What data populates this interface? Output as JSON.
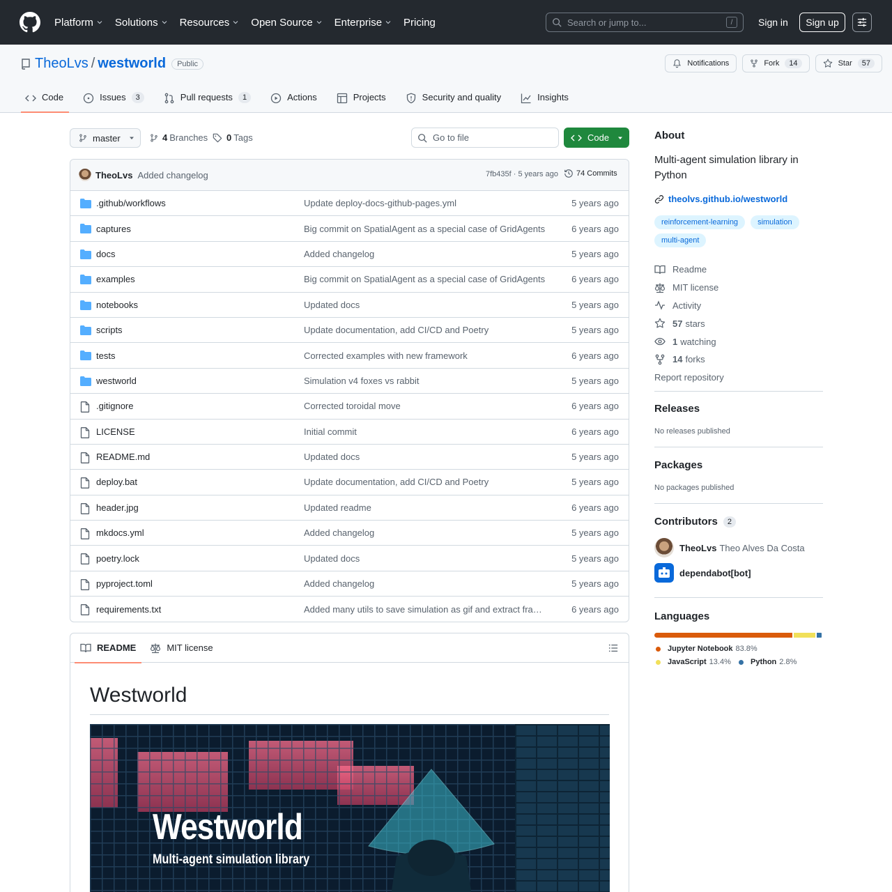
{
  "topnav": {
    "items": [
      "Platform",
      "Solutions",
      "Resources",
      "Open Source",
      "Enterprise",
      "Pricing"
    ],
    "search_placeholder": "Search or jump to...",
    "search_shortcut": "/",
    "signin": "Sign in",
    "signup": "Sign up"
  },
  "repo": {
    "owner": "TheoLvs",
    "separator": "/",
    "name": "westworld",
    "visibility": "Public",
    "notifications": "Notifications",
    "fork_label": "Fork",
    "fork_count": "14",
    "star_label": "Star",
    "star_count": "57"
  },
  "tabs": [
    {
      "label": "Code",
      "count": null,
      "icon": "code-icon",
      "active": true
    },
    {
      "label": "Issues",
      "count": "3",
      "icon": "issue-icon"
    },
    {
      "label": "Pull requests",
      "count": "1",
      "icon": "pull-request-icon"
    },
    {
      "label": "Actions",
      "count": null,
      "icon": "play-icon"
    },
    {
      "label": "Projects",
      "count": null,
      "icon": "table-icon"
    },
    {
      "label": "Security and quality",
      "count": null,
      "icon": "shield-icon"
    },
    {
      "label": "Insights",
      "count": null,
      "icon": "graph-icon"
    }
  ],
  "toolbar": {
    "branch": "master",
    "branches_count": "4",
    "branches_label": "Branches",
    "tags_count": "0",
    "tags_label": "Tags",
    "goto_placeholder": "Go to file",
    "code_button": "Code"
  },
  "latest_commit": {
    "author": "TheoLvs",
    "message": "Added changelog",
    "sha_time": "7fb435f · 5 years ago",
    "commits": "74 Commits"
  },
  "files": [
    {
      "name": ".github/workflows",
      "type": "dir",
      "message": "Update deploy-docs-github-pages.yml",
      "date": "5 years ago"
    },
    {
      "name": "captures",
      "type": "dir",
      "message": "Big commit on SpatialAgent as a special case of GridAgents",
      "date": "6 years ago"
    },
    {
      "name": "docs",
      "type": "dir",
      "message": "Added changelog",
      "date": "5 years ago"
    },
    {
      "name": "examples",
      "type": "dir",
      "message": "Big commit on SpatialAgent as a special case of GridAgents",
      "date": "6 years ago"
    },
    {
      "name": "notebooks",
      "type": "dir",
      "message": "Updated docs",
      "date": "5 years ago"
    },
    {
      "name": "scripts",
      "type": "dir",
      "message": "Update documentation, add CI/CD and Poetry",
      "date": "5 years ago"
    },
    {
      "name": "tests",
      "type": "dir",
      "message": "Corrected examples with new framework",
      "date": "6 years ago"
    },
    {
      "name": "westworld",
      "type": "dir",
      "message": "Simulation v4 foxes vs rabbit",
      "date": "5 years ago"
    },
    {
      "name": ".gitignore",
      "type": "file",
      "message": "Corrected toroidal move",
      "date": "6 years ago"
    },
    {
      "name": "LICENSE",
      "type": "file",
      "message": "Initial commit",
      "date": "6 years ago"
    },
    {
      "name": "README.md",
      "type": "file",
      "message": "Updated docs",
      "date": "5 years ago"
    },
    {
      "name": "deploy.bat",
      "type": "file",
      "message": "Update documentation, add CI/CD and Poetry",
      "date": "5 years ago"
    },
    {
      "name": "header.jpg",
      "type": "file",
      "message": "Updated readme",
      "date": "6 years ago"
    },
    {
      "name": "mkdocs.yml",
      "type": "file",
      "message": "Added changelog",
      "date": "5 years ago"
    },
    {
      "name": "poetry.lock",
      "type": "file",
      "message": "Updated docs",
      "date": "5 years ago"
    },
    {
      "name": "pyproject.toml",
      "type": "file",
      "message": "Added changelog",
      "date": "5 years ago"
    },
    {
      "name": "requirements.txt",
      "type": "file",
      "message": "Added many utils to save simulation as gif and extract frame ...",
      "date": "6 years ago"
    }
  ],
  "readme": {
    "tab_readme": "README",
    "tab_license": "MIT license",
    "heading": "Westworld",
    "banner_title": "Westworld",
    "banner_subtitle": "Multi-agent simulation library"
  },
  "about": {
    "heading": "About",
    "description": "Multi-agent simulation library in Python",
    "link": "theolvs.github.io/westworld",
    "topics": [
      "reinforcement-learning",
      "simulation",
      "multi-agent"
    ],
    "readme": "Readme",
    "license": "MIT license",
    "activity": "Activity",
    "stars_count": "57",
    "stars_label": "stars",
    "watching_count": "1",
    "watching_label": "watching",
    "forks_count": "14",
    "forks_label": "forks",
    "report": "Report repository"
  },
  "releases": {
    "heading": "Releases",
    "text": "No releases published"
  },
  "packages": {
    "heading": "Packages",
    "text": "No packages published"
  },
  "contributors": {
    "heading": "Contributors",
    "count": "2",
    "list": [
      {
        "login": "TheoLvs",
        "full_name": "Theo Alves Da Costa"
      },
      {
        "login": "dependabot[bot]",
        "full_name": ""
      }
    ]
  },
  "languages": {
    "heading": "Languages",
    "list": [
      {
        "name": "Jupyter Notebook",
        "pct": "83.8%",
        "share": 83.8,
        "color": "#DA5B0B"
      },
      {
        "name": "JavaScript",
        "pct": "13.4%",
        "share": 13.4,
        "color": "#f1e05a"
      },
      {
        "name": "Python",
        "pct": "2.8%",
        "share": 2.8,
        "color": "#3572A5"
      }
    ]
  },
  "colors": {
    "header_bg": "#24292f",
    "accent_blue": "#0969da",
    "code_button_green": "#1f883d",
    "tab_underline": "#fd8c73"
  }
}
